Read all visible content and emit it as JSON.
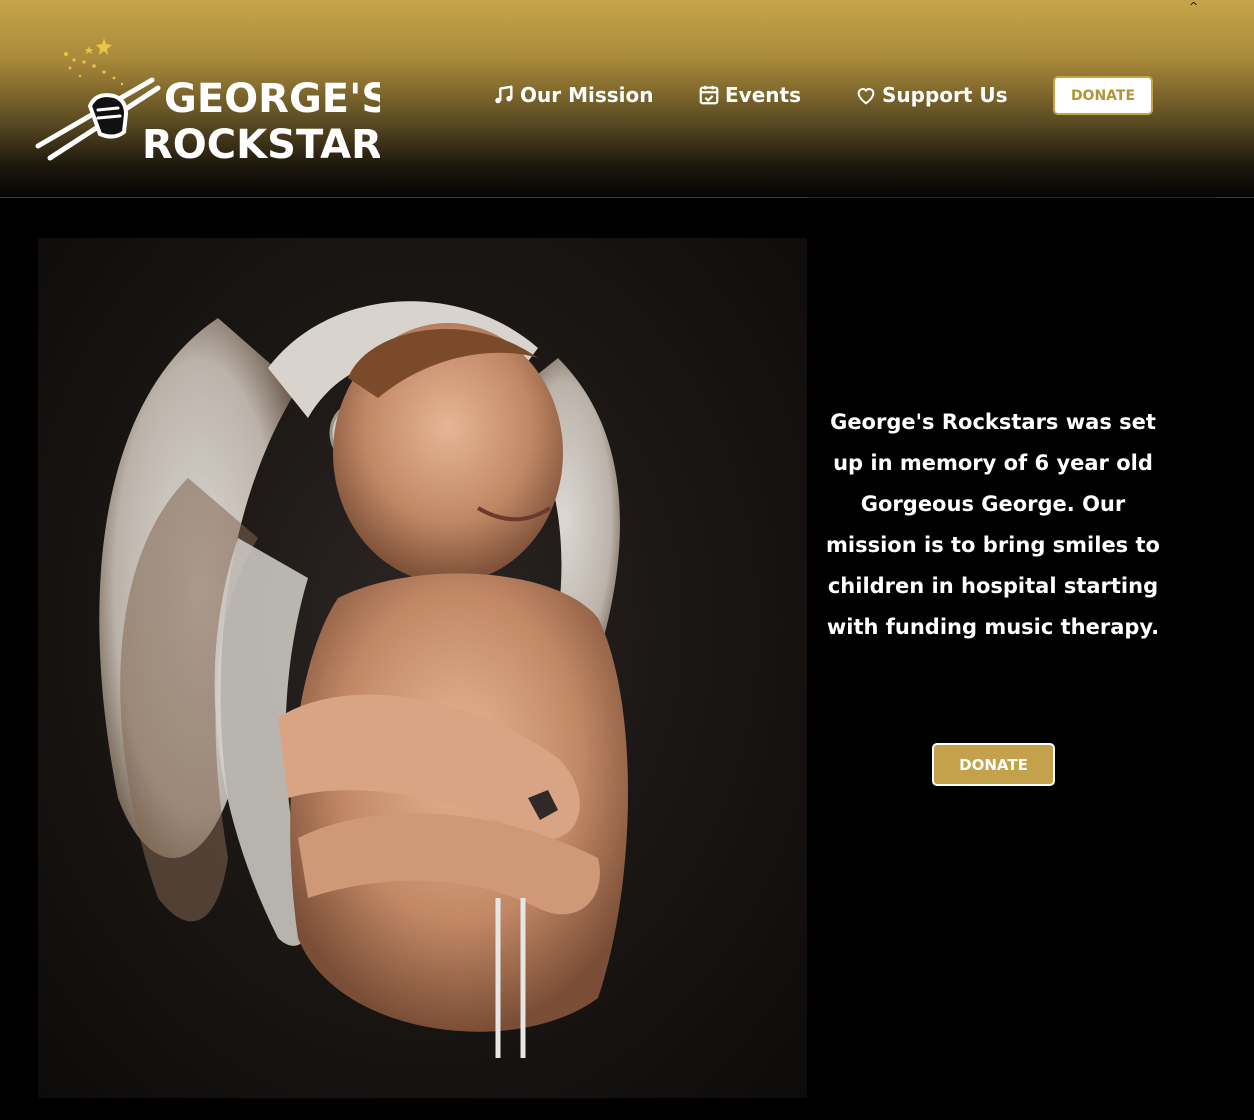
{
  "header": {
    "caret": "^",
    "logo": {
      "line1": "GEORGE'S",
      "line2": "ROCKSTARS",
      "icon": "hand-drumsticks-icon",
      "sparkle_color": "#e8c54a"
    },
    "nav": [
      {
        "label": "Our Mission",
        "icon": "music-note-icon"
      },
      {
        "label": "Events",
        "icon": "calendar-check-icon"
      },
      {
        "label": "Support Us",
        "icon": "heart-icon"
      }
    ],
    "donate_label": "DONATE"
  },
  "hero": {
    "photo_alt": "Child wearing a white feathered headdress with arms crossed",
    "mission_text": "George's Rockstars was set up in memory of 6 year old Gorgeous George. Our mission is to bring smiles to children in hospital starting with funding music therapy.",
    "donate_label": "DONATE"
  },
  "colors": {
    "gold": "#c6a54a",
    "donate_fill": "#c3a24b",
    "background": "#000000",
    "text": "#ffffff"
  }
}
